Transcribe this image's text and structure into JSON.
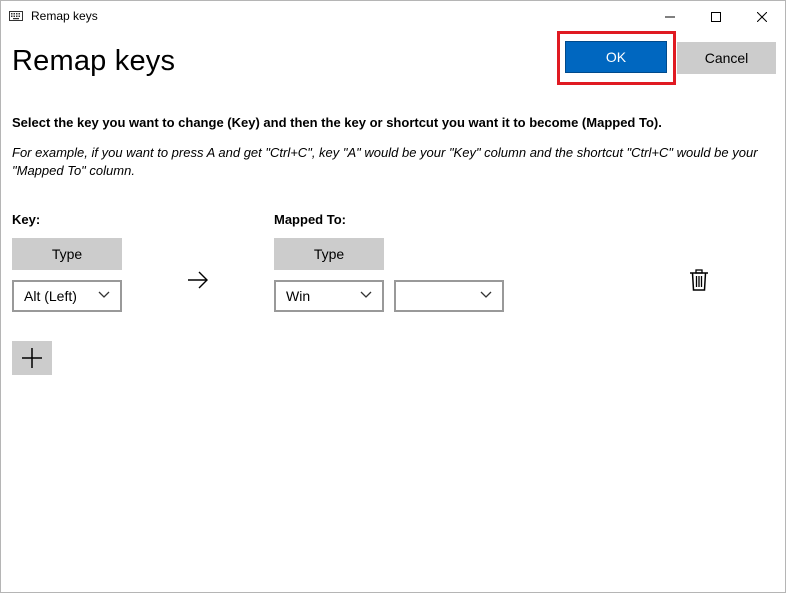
{
  "window": {
    "title": "Remap keys",
    "app_icon": "keyboard-icon",
    "controls": [
      "minimize-icon",
      "maximize-icon",
      "close-icon"
    ]
  },
  "header": {
    "title": "Remap keys",
    "ok_label": "OK",
    "cancel_label": "Cancel",
    "accent_color": "#0067c0",
    "highlight_color": "#e01a22"
  },
  "instructions": {
    "main": "Select the key you want to change (Key) and then the key or shortcut you want it to become (Mapped To).",
    "example": "For example, if you want to press A and get \"Ctrl+C\", key \"A\" would be your \"Key\" column and the shortcut \"Ctrl+C\" would be your \"Mapped To\" column."
  },
  "columns": {
    "key_label": "Key:",
    "mapped_label": "Mapped To:"
  },
  "row": {
    "key_type_label": "Type",
    "key_value": "Alt (Left)",
    "arrow_icon": "right-arrow-icon",
    "mapped_type_label": "Type",
    "mapped_value_1": "Win",
    "mapped_value_2": "",
    "delete_icon": "trash-icon"
  },
  "add_button_icon": "plus-icon"
}
